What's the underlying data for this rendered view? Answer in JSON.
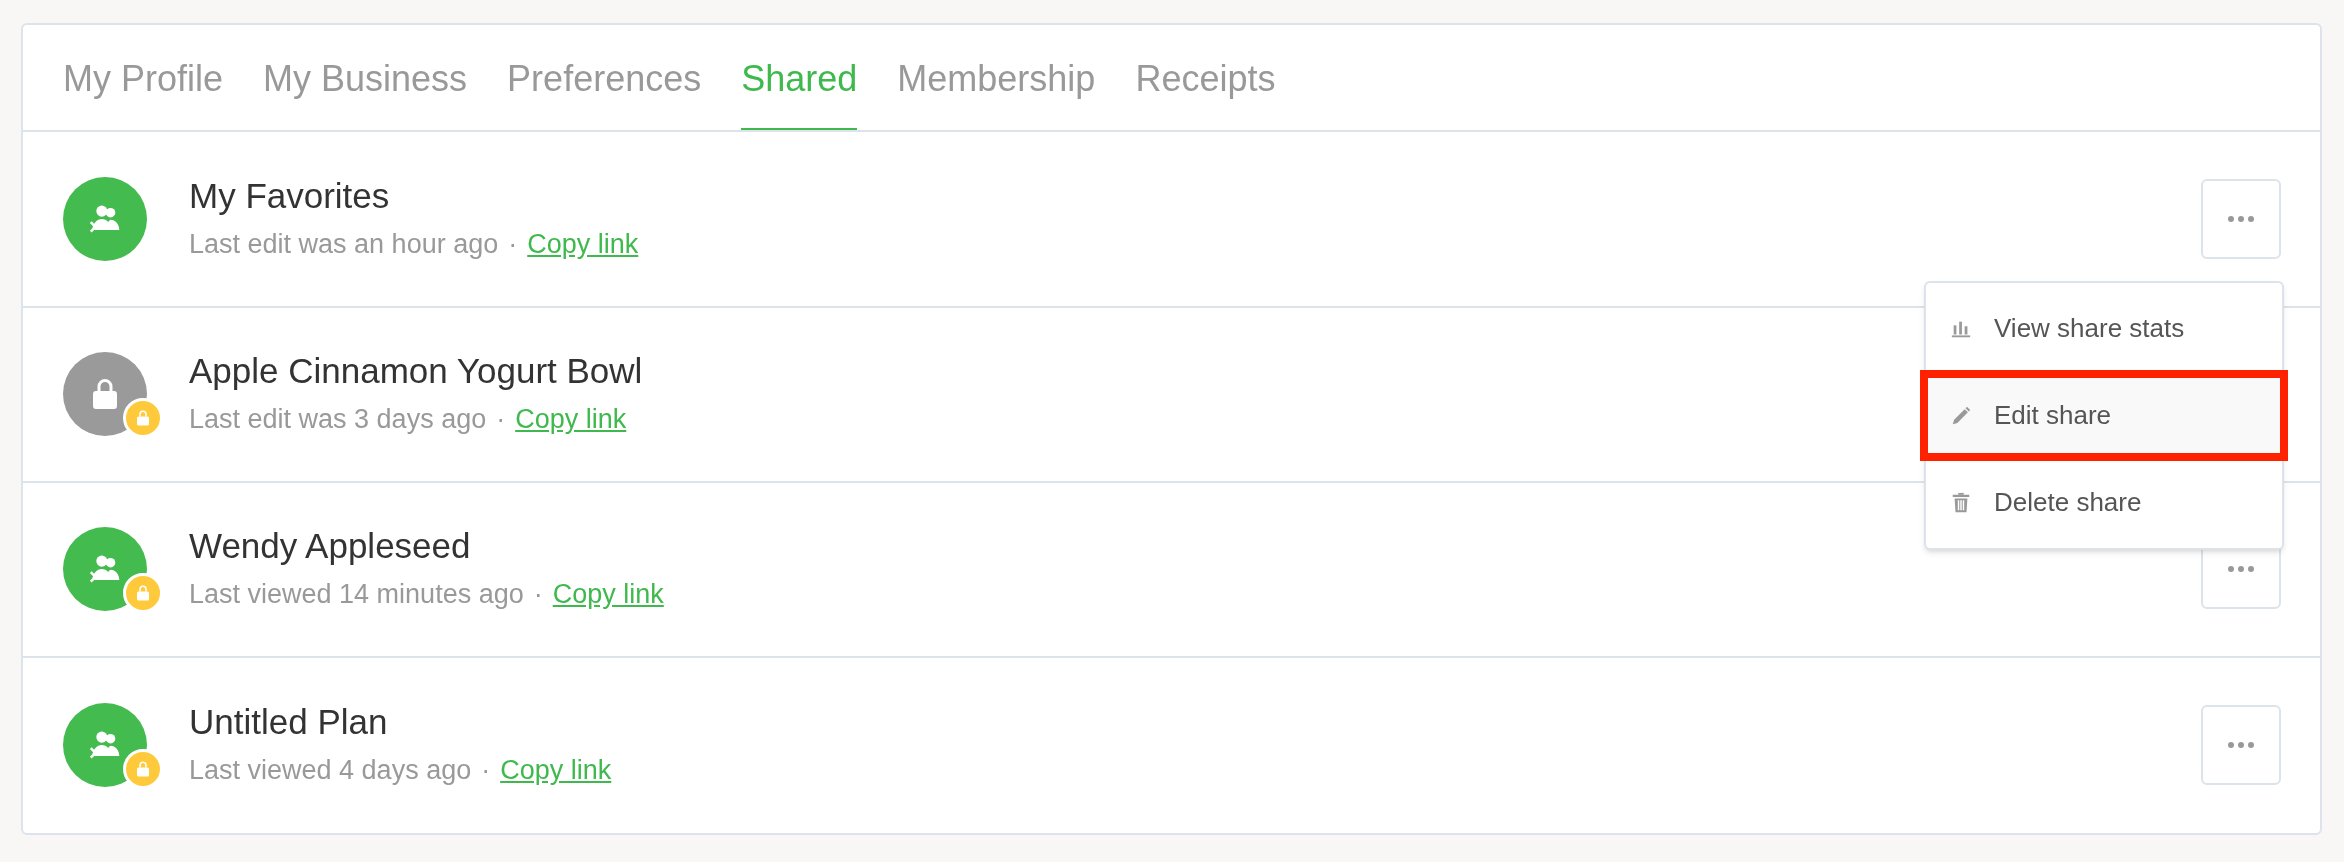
{
  "tabs": [
    {
      "label": "My Profile",
      "selected": false
    },
    {
      "label": "My Business",
      "selected": false
    },
    {
      "label": "Preferences",
      "selected": false
    },
    {
      "label": "Shared",
      "selected": true
    },
    {
      "label": "Membership",
      "selected": false
    },
    {
      "label": "Receipts",
      "selected": false
    }
  ],
  "shares": [
    {
      "title": "My Favorites",
      "status": "Last edit was an hour ago",
      "separator": "·",
      "link": "Copy link",
      "kind": "group",
      "locked": false
    },
    {
      "title": "Apple Cinnamon Yogurt Bowl",
      "status": "Last edit was 3 days ago",
      "separator": "·",
      "link": "Copy link",
      "kind": "lock",
      "locked": true
    },
    {
      "title": "Wendy Appleseed",
      "status": "Last viewed 14 minutes ago",
      "separator": "·",
      "link": "Copy link",
      "kind": "group",
      "locked": true
    },
    {
      "title": "Untitled Plan",
      "status": "Last viewed 4 days ago",
      "separator": "·",
      "link": "Copy link",
      "kind": "group",
      "locked": true
    }
  ],
  "menu": {
    "items": [
      {
        "label": "View share stats",
        "kind": "stats",
        "highlighted": false
      },
      {
        "label": "Edit share",
        "kind": "edit",
        "highlighted": true
      },
      {
        "label": "Delete share",
        "kind": "delete",
        "highlighted": false
      }
    ]
  }
}
